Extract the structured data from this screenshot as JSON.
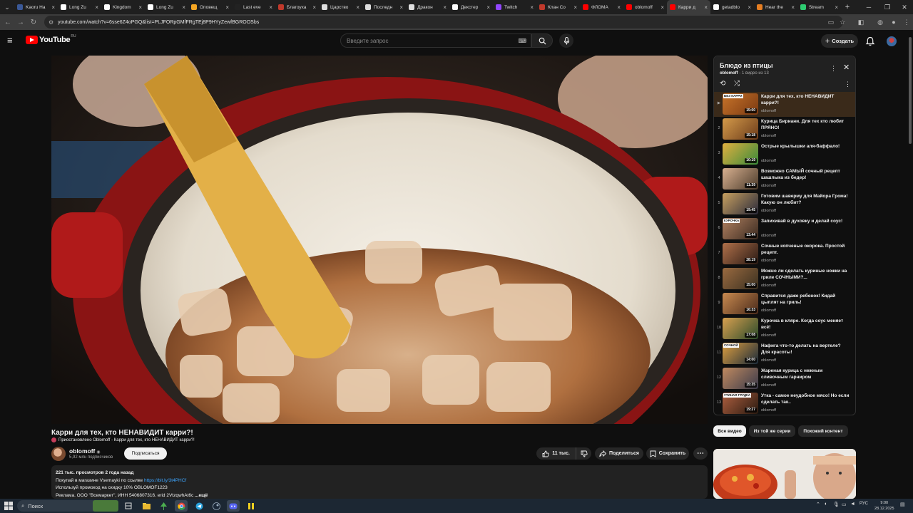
{
  "browser": {
    "tabs": [
      {
        "title": "Kaoru Ha",
        "color": "#3b5998",
        "active": false
      },
      {
        "title": "Long Zu",
        "color": "#ffffff",
        "active": false
      },
      {
        "title": "Kingdom",
        "color": "#ffffff",
        "active": false
      },
      {
        "title": "Long Zu",
        "color": "#ffffff",
        "active": false
      },
      {
        "title": "Оповещ",
        "color": "#f5a623",
        "active": false
      },
      {
        "title": "Last eve",
        "color": "#222222",
        "active": false
      },
      {
        "title": "Благоуха",
        "color": "#c0392b",
        "active": false
      },
      {
        "title": "Царство",
        "color": "#dddddd",
        "active": false
      },
      {
        "title": "Последн",
        "color": "#dddddd",
        "active": false
      },
      {
        "title": "Дракон",
        "color": "#dddddd",
        "active": false
      },
      {
        "title": "Декстер",
        "color": "#ffffff",
        "active": false
      },
      {
        "title": "Twitch",
        "color": "#9146ff",
        "active": false
      },
      {
        "title": "Клан Со",
        "color": "#c0392b",
        "active": false
      },
      {
        "title": "ФЛОМА",
        "color": "#ff0000",
        "active": false
      },
      {
        "title": "oblomoff",
        "color": "#ff0000",
        "active": false
      },
      {
        "title": "Карри д",
        "color": "#ff0000",
        "active": true
      },
      {
        "title": "getadblo",
        "color": "#ffffff",
        "active": false
      },
      {
        "title": "Hear the",
        "color": "#e67e22",
        "active": false
      },
      {
        "title": "Stream",
        "color": "#2ecc71",
        "active": false
      }
    ],
    "url": "youtube.com/watch?v=6sse6Z4oPGQ&list=PLJFORpGMfFRgTEj8P9HYyZewfBGROOSbs"
  },
  "header": {
    "logo": "YouTube",
    "region": "RU",
    "search_placeholder": "Введите запрос",
    "create_label": "Создать"
  },
  "video": {
    "title": "Карри для тех, кто НЕНАВИДИТ карри?!",
    "pinned": "Приостановлено Oblomoff - Карри для тех, кто НЕНАВИДИТ карри?!",
    "channel": "oblomoff",
    "subscribers": "5,92 млн подписчиков",
    "subscribe_label": "Подписаться",
    "likes": "11 тыс.",
    "share_label": "Поделиться",
    "save_label": "Сохранить",
    "description": {
      "meta": "221 тыс. просмотров  2 года назад",
      "line1_text": "Покупай в магазине Vsemayki по ссылке ",
      "line1_link": "https://bit.ly/3t4PHCf",
      "line2": "Используй промокод на скидку 10% OBLOMOF1223",
      "line3": "Реклама. ООО \"Всемаркет\", ИНН 5406807316. erid 2VtzqwhAt6c",
      "more": "...ещё"
    }
  },
  "playlist": {
    "title": "Блюдо из птицы",
    "owner": "oblomoff",
    "position": "1 видео из 13",
    "items": [
      {
        "index": "▶",
        "title": "Карри для тех, кто НЕНАВИДИТ карри?!",
        "channel": "oblomoff",
        "duration": "15:00",
        "tag": "БЕЗ КАРРИ",
        "colors": [
          "#c9742a",
          "#7a3a12"
        ]
      },
      {
        "index": "2",
        "title": "Курица Бириани. Для тех кто любит ПРЯНО!",
        "channel": "oblomoff",
        "duration": "15:18",
        "tag": "",
        "colors": [
          "#d49a4a",
          "#6b3b1a"
        ]
      },
      {
        "index": "3",
        "title": "Острые крылышки аля-баффало!",
        "channel": "oblomoff",
        "duration": "10:19",
        "tag": "",
        "colors": [
          "#e0b040",
          "#3a8a3a"
        ]
      },
      {
        "index": "4",
        "title": "Возможно САМЫЙ сочный рецепт шашлыка из бедер!",
        "channel": "oblomoff",
        "duration": "11:39",
        "tag": "",
        "colors": [
          "#d8b090",
          "#4a3a2a"
        ]
      },
      {
        "index": "5",
        "title": "Готовим шаверму для Майора Грома! Какую он любит?",
        "channel": "oblomoff",
        "duration": "19:45",
        "tag": "",
        "colors": [
          "#c8a060",
          "#2a2a3a"
        ]
      },
      {
        "index": "6",
        "title": "Запихивай в духовку и делай соус!",
        "channel": "oblomoff",
        "duration": "13:44",
        "tag": "КУРОЧКА",
        "colors": [
          "#b08060",
          "#3a2a20"
        ]
      },
      {
        "index": "7",
        "title": "Сочные копченые окорока. Простой рецепт.",
        "channel": "oblomoff",
        "duration": "28:19",
        "tag": "",
        "colors": [
          "#b0704a",
          "#2a1a14"
        ]
      },
      {
        "index": "8",
        "title": "Можно ли сделать куриные ножки на гриле СОЧНЫМИ?...",
        "channel": "oblomoff",
        "duration": "15:00",
        "tag": "",
        "colors": [
          "#9a6a40",
          "#3a3020"
        ]
      },
      {
        "index": "9",
        "title": "Справится даже ребенок! Кидай цыплят на гриль!",
        "channel": "oblomoff",
        "duration": "16:33",
        "tag": "",
        "colors": [
          "#c88a50",
          "#4a2a1a"
        ]
      },
      {
        "index": "10",
        "title": "Курочка в кляре. Когда соус меняет всё!",
        "channel": "oblomoff",
        "duration": "17:08",
        "tag": "",
        "colors": [
          "#d8a050",
          "#2a4a2a"
        ]
      },
      {
        "index": "11",
        "title": "Нафига что-то делать на вертеле? Для красоты!",
        "channel": "oblomoff",
        "duration": "14:00",
        "tag": "СОЧНОЙ",
        "colors": [
          "#e0a040",
          "#1a2a3a"
        ]
      },
      {
        "index": "12",
        "title": "Жареная курица с нежным сливочным гарниром",
        "channel": "oblomoff",
        "duration": "15:35",
        "tag": "",
        "colors": [
          "#c08a60",
          "#3a3a4a"
        ]
      },
      {
        "index": "13",
        "title": "Утка - самое неудобное мясо! Но если сделать так..",
        "channel": "oblomoff",
        "duration": "19:27",
        "tag": "УТИНАЯ ГРУДКА",
        "colors": [
          "#b06040",
          "#2a1a10"
        ]
      }
    ]
  },
  "chips": [
    "Все видео",
    "Из той же серии",
    "Похожий контент"
  ],
  "taskbar": {
    "search_label": "Поиск",
    "lang": "РУС",
    "time": "9:00",
    "date": "28.12.2025"
  },
  "colors": {
    "accent_red": "#ff0000",
    "link": "#3ea6ff",
    "background": "#0f0f0f"
  }
}
